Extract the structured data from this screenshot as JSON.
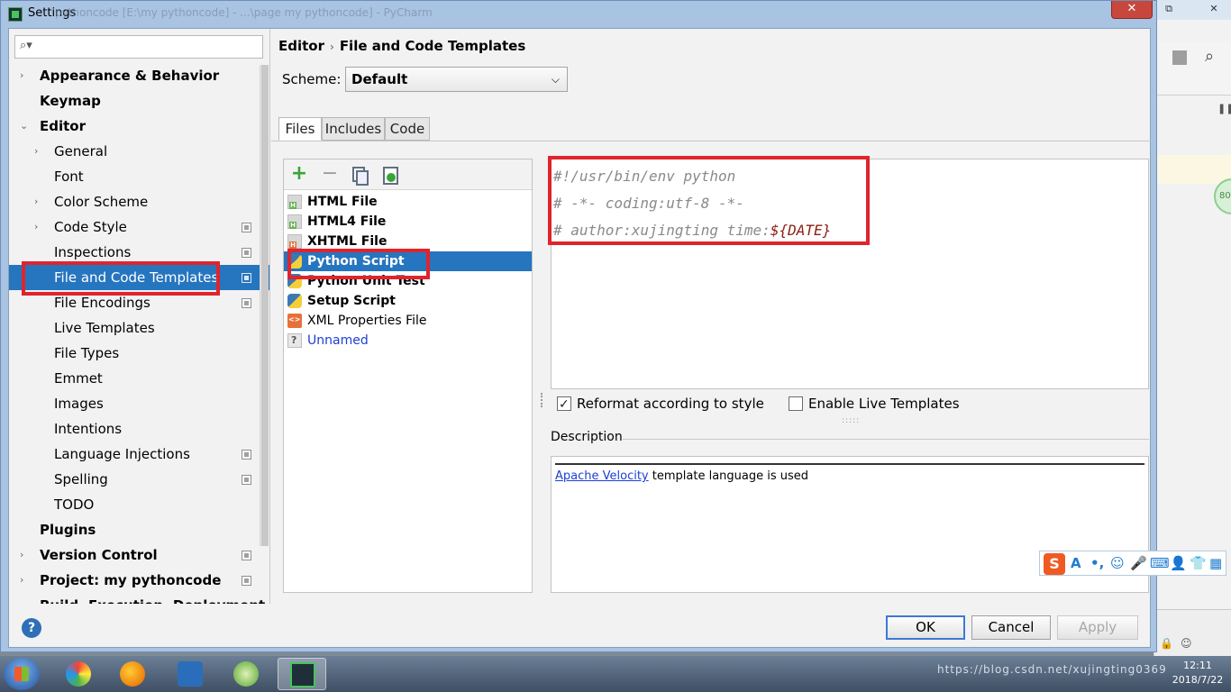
{
  "window": {
    "title": "Settings",
    "behind_title": "pythoncode [E:\\my pythoncode] - ...\\page my pythoncode] - PyCharm",
    "close_label": "✕"
  },
  "search": {
    "placeholder": "",
    "icon": "search-icon"
  },
  "tree": [
    {
      "label": "Appearance & Behavior",
      "bold": true,
      "arrow": "›",
      "indent": 0
    },
    {
      "label": "Keymap",
      "bold": true,
      "arrow": "",
      "indent": 0
    },
    {
      "label": "Editor",
      "bold": true,
      "arrow": "⌄",
      "indent": 0
    },
    {
      "label": "General",
      "bold": false,
      "arrow": "›",
      "indent": 1
    },
    {
      "label": "Font",
      "bold": false,
      "arrow": "",
      "indent": 1
    },
    {
      "label": "Color Scheme",
      "bold": false,
      "arrow": "›",
      "indent": 1
    },
    {
      "label": "Code Style",
      "bold": false,
      "arrow": "›",
      "indent": 1,
      "copy": true
    },
    {
      "label": "Inspections",
      "bold": false,
      "arrow": "",
      "indent": 1,
      "copy": true
    },
    {
      "label": "File and Code Templates",
      "bold": false,
      "arrow": "",
      "indent": 1,
      "copy": true,
      "selected": true
    },
    {
      "label": "File Encodings",
      "bold": false,
      "arrow": "",
      "indent": 1,
      "copy": true
    },
    {
      "label": "Live Templates",
      "bold": false,
      "arrow": "",
      "indent": 1
    },
    {
      "label": "File Types",
      "bold": false,
      "arrow": "",
      "indent": 1
    },
    {
      "label": "Emmet",
      "bold": false,
      "arrow": "",
      "indent": 1
    },
    {
      "label": "Images",
      "bold": false,
      "arrow": "",
      "indent": 1
    },
    {
      "label": "Intentions",
      "bold": false,
      "arrow": "",
      "indent": 1
    },
    {
      "label": "Language Injections",
      "bold": false,
      "arrow": "",
      "indent": 1,
      "copy": true
    },
    {
      "label": "Spelling",
      "bold": false,
      "arrow": "",
      "indent": 1,
      "copy": true
    },
    {
      "label": "TODO",
      "bold": false,
      "arrow": "",
      "indent": 1
    },
    {
      "label": "Plugins",
      "bold": true,
      "arrow": "",
      "indent": 0
    },
    {
      "label": "Version Control",
      "bold": true,
      "arrow": "›",
      "indent": 0,
      "copy": true
    },
    {
      "label": "Project: my pythoncode",
      "bold": true,
      "arrow": "›",
      "indent": 0,
      "copy": true
    },
    {
      "label": "Build, Execution, Deployment",
      "bold": true,
      "arrow": "›",
      "indent": 0
    }
  ],
  "breadcrumb": {
    "parent": "Editor",
    "separator": "›",
    "current": "File and Code Templates"
  },
  "scheme": {
    "label": "Scheme:",
    "value": "Default"
  },
  "tabs": [
    {
      "label": "Files",
      "active": true
    },
    {
      "label": "Includes",
      "active": false
    },
    {
      "label": "Code",
      "active": false
    }
  ],
  "toolbar": {
    "add": "+",
    "remove": "−"
  },
  "files": [
    {
      "name": "HTML File",
      "bold": true,
      "icon": "html"
    },
    {
      "name": "HTML4 File",
      "bold": true,
      "icon": "html"
    },
    {
      "name": "XHTML File",
      "bold": true,
      "icon": "xhtml"
    },
    {
      "name": "Python Script",
      "bold": true,
      "icon": "py",
      "selected": true
    },
    {
      "name": "Python Unit Test",
      "bold": true,
      "icon": "py"
    },
    {
      "name": "Setup Script",
      "bold": true,
      "icon": "py"
    },
    {
      "name": "XML Properties File",
      "bold": false,
      "icon": "xml"
    },
    {
      "name": "Unnamed",
      "bold": false,
      "icon": "unnamed",
      "link": true
    }
  ],
  "editor": {
    "lines": [
      {
        "text": "#!/usr/bin/env python",
        "var": ""
      },
      {
        "text": "# -*- coding:utf-8 -*-",
        "var": ""
      },
      {
        "text": "# author:xujingting time:",
        "var": "${DATE}"
      }
    ]
  },
  "options": {
    "reformat": {
      "label": "Reformat according to style",
      "checked": true
    },
    "live_templates": {
      "label": "Enable Live Templates",
      "checked": false
    }
  },
  "description": {
    "label": "Description",
    "link": "Apache Velocity",
    "text": " template language is used"
  },
  "ime": {
    "logo": "S",
    "items": [
      "A",
      "•,",
      "☺",
      "🎤",
      "⌨",
      "👤",
      "👕",
      "▦"
    ]
  },
  "footer": {
    "help": "?",
    "ok": "OK",
    "cancel": "Cancel",
    "apply": "Apply"
  },
  "taskbar": {
    "tray_text": "https://blog.csdn.net/xujingting0369",
    "time": "12:11",
    "date": "2018/7/22"
  },
  "colors": {
    "selection": "#2675bf",
    "highlight_box": "#e0242c",
    "accent_green": "#3aa33a"
  }
}
